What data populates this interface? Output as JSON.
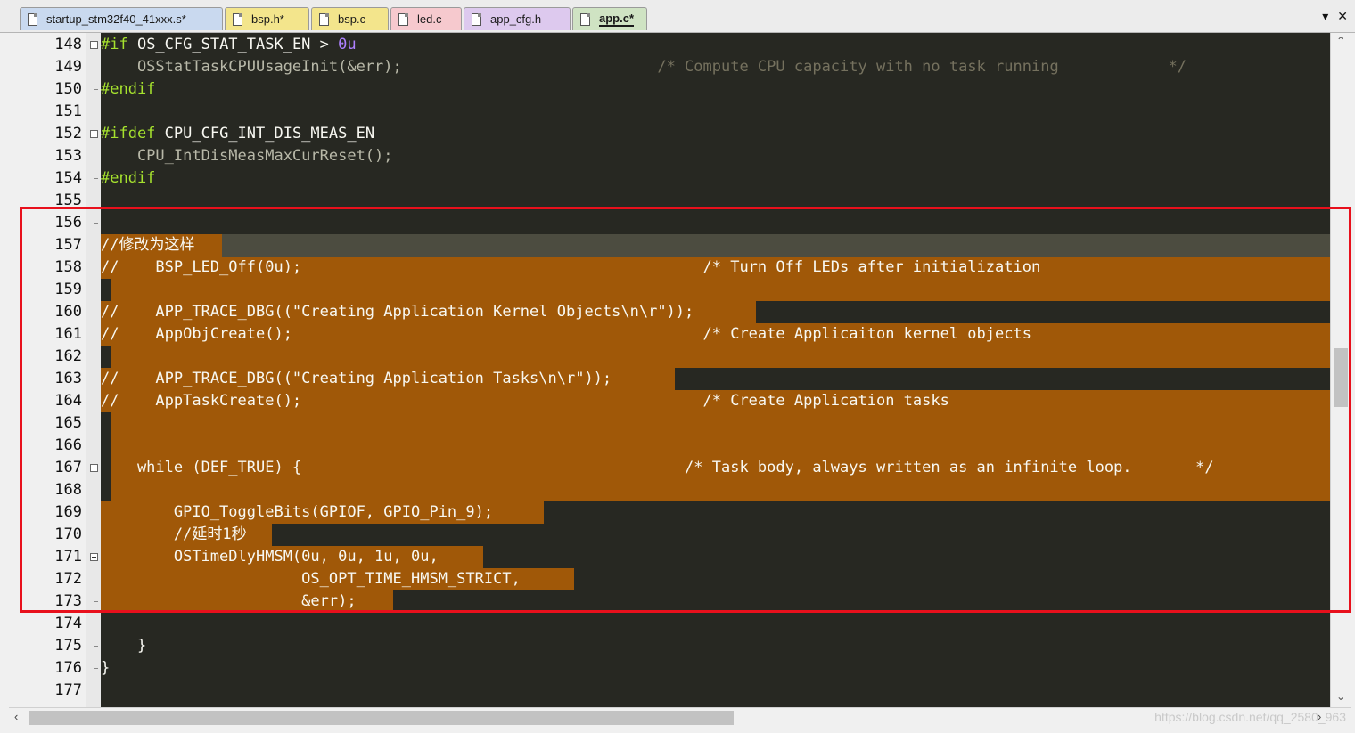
{
  "tabs": [
    {
      "label": "startup_stm32f40_41xxx.s*",
      "color": "#c9d9ef"
    },
    {
      "label": "bsp.h*",
      "color": "#f3e58c"
    },
    {
      "label": "bsp.c",
      "color": "#f3e58c"
    },
    {
      "label": "led.c",
      "color": "#f6c9ce"
    },
    {
      "label": "app_cfg.h",
      "color": "#ddc9ee"
    },
    {
      "label": "app.c*",
      "color": "#cfe3c3",
      "active": true
    }
  ],
  "tab_controls": {
    "dropdown": "▾",
    "close": "✕"
  },
  "editor": {
    "colors": {
      "background": "#272822",
      "default": "#f8f8f2",
      "preprocessor": "#a6e22e",
      "comment": "#75715e",
      "number": "#ae81ff",
      "selection": "#a05808",
      "current_line": "#4c4c40"
    },
    "lines": [
      {
        "num": "148",
        "fold": "box",
        "parts": [
          {
            "t": "#if",
            "c": "preprocessor"
          },
          {
            "t": " OS_CFG_STAT_TASK_EN > "
          },
          {
            "t": "0u",
            "c": "number"
          }
        ]
      },
      {
        "num": "149",
        "fold": "line",
        "parts": [
          {
            "t": "    OSStatTaskCPUUsageInit(&err);",
            "c": "dim"
          },
          {
            "t": "                            /* Compute CPU capacity with no task running            */",
            "c": "comment"
          }
        ]
      },
      {
        "num": "150",
        "fold": "end",
        "parts": [
          {
            "t": "#endif",
            "c": "preprocessor"
          }
        ]
      },
      {
        "num": "151",
        "fold": "",
        "parts": []
      },
      {
        "num": "152",
        "fold": "box",
        "parts": [
          {
            "t": "#ifdef",
            "c": "preprocessor"
          },
          {
            "t": " CPU_CFG_INT_DIS_MEAS_EN"
          }
        ]
      },
      {
        "num": "153",
        "fold": "line",
        "parts": [
          {
            "t": "    CPU_IntDisMeasMaxCurReset();",
            "c": "dim"
          }
        ]
      },
      {
        "num": "154",
        "fold": "end",
        "parts": [
          {
            "t": "#endif",
            "c": "preprocessor"
          }
        ]
      },
      {
        "num": "155",
        "fold": "",
        "parts": []
      },
      {
        "num": "156",
        "fold": "tick",
        "parts": []
      },
      {
        "num": "157",
        "fold": "",
        "current": true,
        "sel_to": 12,
        "parts": [
          {
            "t": "//修改为这样"
          }
        ]
      },
      {
        "num": "158",
        "fold": "",
        "sel_to": 122,
        "parts": [
          {
            "t": "//    BSP_LED_Off(0u);                                            /* Turn Off LEDs after initialization"
          }
        ]
      },
      {
        "num": "159",
        "fold": "",
        "sel_to": 122,
        "sel_from": 1,
        "parts": []
      },
      {
        "num": "160",
        "fold": "",
        "sel_to": 65,
        "parts": [
          {
            "t": "//    APP_TRACE_DBG((\"Creating Application Kernel Objects\\n\\r\"));"
          }
        ]
      },
      {
        "num": "161",
        "fold": "",
        "sel_to": 122,
        "parts": [
          {
            "t": "//    AppObjCreate();                                             /* Create Applicaiton kernel objects"
          }
        ]
      },
      {
        "num": "162",
        "fold": "",
        "sel_to": 122,
        "sel_from": 1,
        "parts": []
      },
      {
        "num": "163",
        "fold": "",
        "sel_to": 57,
        "parts": [
          {
            "t": "//    APP_TRACE_DBG((\"Creating Application Tasks\\n\\r\"));"
          }
        ]
      },
      {
        "num": "164",
        "fold": "",
        "sel_to": 122,
        "parts": [
          {
            "t": "//    AppTaskCreate();                                            /* Create Application tasks"
          }
        ]
      },
      {
        "num": "165",
        "fold": "",
        "sel_to": 122,
        "sel_from": 1,
        "parts": []
      },
      {
        "num": "166",
        "fold": "",
        "sel_to": 122,
        "sel_from": 1,
        "parts": []
      },
      {
        "num": "167",
        "fold": "box",
        "sel_to": 122,
        "sel_from": 1,
        "parts": [
          {
            "t": "    while (DEF_TRUE) {                                          /* Task body, always written as an infinite loop.       */"
          }
        ]
      },
      {
        "num": "168",
        "fold": "line",
        "sel_to": 122,
        "sel_from": 1,
        "parts": []
      },
      {
        "num": "169",
        "fold": "line",
        "sel_to": 44,
        "parts": [
          {
            "t": "        GPIO_ToggleBits(GPIOF, GPIO_Pin_9);"
          }
        ]
      },
      {
        "num": "170",
        "fold": "line",
        "sel_to": 17,
        "parts": [
          {
            "t": "        //延时1秒"
          }
        ]
      },
      {
        "num": "171",
        "fold": "box",
        "sel_to": 38,
        "parts": [
          {
            "t": "        OSTimeDlyHMSM(0u, 0u, 1u, 0u,"
          }
        ]
      },
      {
        "num": "172",
        "fold": "line",
        "sel_to": 47,
        "parts": [
          {
            "t": "                      OS_OPT_TIME_HMSM_STRICT,"
          }
        ]
      },
      {
        "num": "173",
        "fold": "end",
        "sel_to": 29,
        "parts": [
          {
            "t": "                      &err);"
          }
        ]
      },
      {
        "num": "174",
        "fold": "line",
        "parts": []
      },
      {
        "num": "175",
        "fold": "end",
        "parts": [
          {
            "t": "    }"
          }
        ]
      },
      {
        "num": "176",
        "fold": "end",
        "parts": [
          {
            "t": "}"
          }
        ]
      },
      {
        "num": "177",
        "fold": "",
        "parts": []
      }
    ]
  },
  "scroll": {
    "up": "⌃",
    "down": "⌄",
    "left": "‹",
    "right": "›"
  },
  "watermark": "https://blog.csdn.net/qq_2580_963"
}
